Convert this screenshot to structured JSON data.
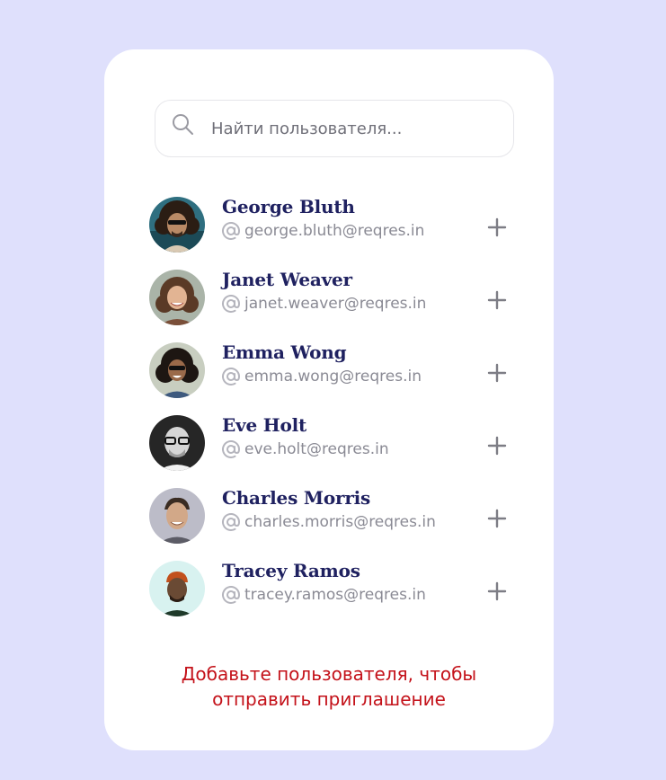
{
  "search": {
    "placeholder": "Найти пользователя...",
    "icon": "search-icon"
  },
  "users": [
    {
      "name": "George Bluth",
      "email": "george.bluth@reqres.in",
      "avatar_bg": "#2e6e7e"
    },
    {
      "name": "Janet Weaver",
      "email": "janet.weaver@reqres.in",
      "avatar_bg": "#a8b3a6"
    },
    {
      "name": "Emma Wong",
      "email": "emma.wong@reqres.in",
      "avatar_bg": "#c9cfc2"
    },
    {
      "name": "Eve Holt",
      "email": "eve.holt@reqres.in",
      "avatar_bg": "#2a2a2a"
    },
    {
      "name": "Charles Morris",
      "email": "charles.morris@reqres.in",
      "avatar_bg": "#b9b9c4"
    },
    {
      "name": "Tracey Ramos",
      "email": "tracey.ramos@reqres.in",
      "avatar_bg": "#d6f1ef"
    }
  ],
  "hint": {
    "line1": "Добавьте пользователя, чтобы",
    "line2": "отправить приглашение"
  },
  "colors": {
    "background": "#dfe0fc",
    "name": "#1f2160",
    "email": "#8a8a94",
    "hint": "#c4121a"
  }
}
